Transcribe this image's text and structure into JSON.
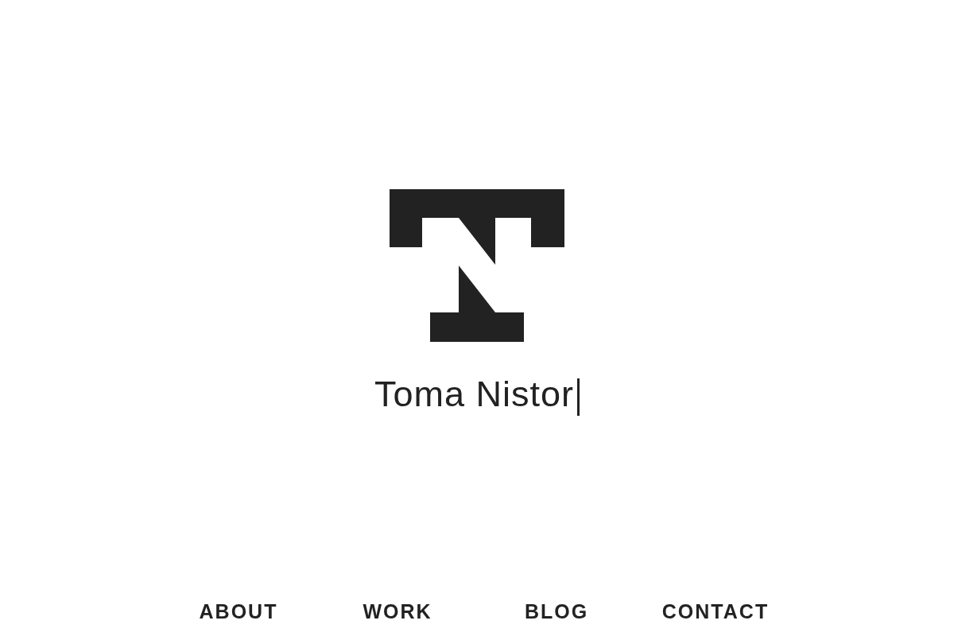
{
  "header": {
    "name": "Toma Nistor"
  },
  "nav": [
    {
      "label": "ABOUT"
    },
    {
      "label": "WORK"
    },
    {
      "label": "BLOG"
    },
    {
      "label": "CONTACT"
    }
  ]
}
